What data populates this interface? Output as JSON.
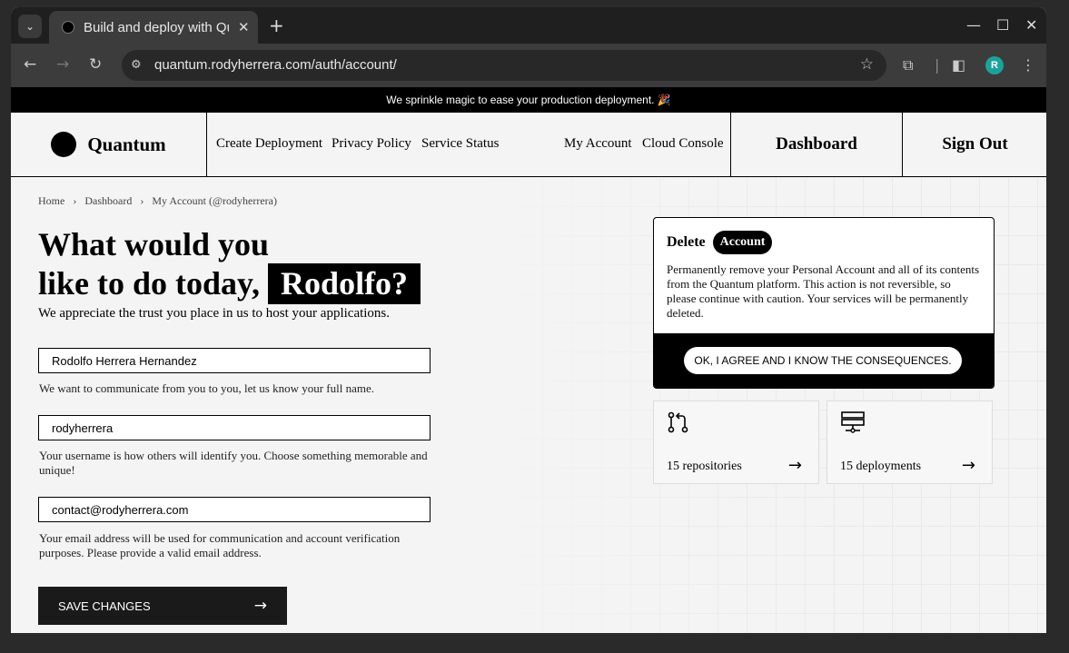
{
  "browser": {
    "tab_title": "Build and deploy with Qu",
    "tab_dropdown": "⌄",
    "tab_close": "✕",
    "new_tab": "+",
    "url": "quantum.rodyherrera.com/auth/account/",
    "profile_initial": "R",
    "window_controls": [
      "—",
      "☐",
      "✕"
    ]
  },
  "banner": {
    "text": "We sprinkle magic to ease your production deployment. 🎉"
  },
  "nav": {
    "logo_text": "Quantum",
    "links": [
      "Create Deployment",
      "Privacy Policy",
      "Service Status",
      "My Account",
      "Cloud Console"
    ],
    "dashboard_label": "Dashboard",
    "signout_label": "Sign Out"
  },
  "breadcrumb": [
    "Home",
    "›",
    "Dashboard",
    "›",
    "My Account (@rodyherrera)"
  ],
  "hero": {
    "line1": "What would you",
    "line2": "like to do today,",
    "name": "Rodolfo?",
    "subtitle": "We appreciate the trust you place in us to host your applications."
  },
  "form": {
    "fullname_value": "Rodolfo Herrera Hernandez",
    "fullname_help": "We want to communicate from you to you, let us know your full name.",
    "username_value": "rodyherrera",
    "username_help": "Your username is how others will identify you. Choose something memorable and unique!",
    "email_value": "contact@rodyherrera.com",
    "email_help": "Your email address will be used for communication and account verification purposes. Please provide a valid email address.",
    "save_label": "SAVE CHANGES",
    "save_arrow": "→"
  },
  "delete_card": {
    "title": "Delete",
    "pill": "Account",
    "description": "Permanently remove your Personal Account and all of its contents from the Quantum platform. This action is not reversible, so please continue with caution. Your services will be permanently deleted.",
    "agree_label": "OK, I AGREE AND I KNOW THE CONSEQUENCES."
  },
  "stats": [
    {
      "label": "15 repositories",
      "icon": "git-pull-request-icon",
      "arrow": "→"
    },
    {
      "label": "15 deployments",
      "icon": "server-icon",
      "arrow": "→"
    }
  ]
}
